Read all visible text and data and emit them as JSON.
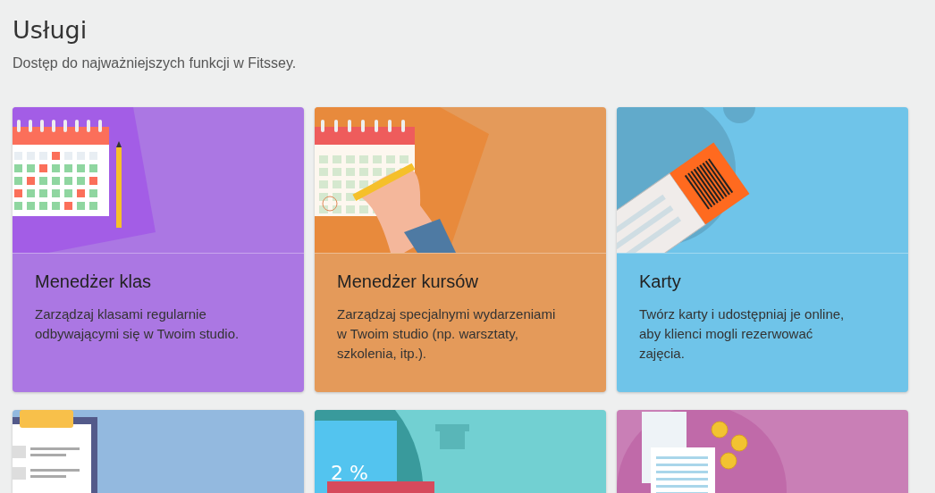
{
  "title": "Usługi",
  "subtitle": "Dostęp do najważniejszych funkcji w Fitssey.",
  "cards": [
    {
      "kind": "calendar",
      "color": "#ab77e3",
      "title": "Menedżer klas",
      "description": "Zarządzaj klasami regularnie odbywającymi się w Twoim studio."
    },
    {
      "kind": "hand",
      "color": "#e49a5a",
      "title": "Menedżer kursów",
      "description": "Zarządzaj specjalnymi wydarzeniami w Twoim studio (np. warsztaty, szkolenia, itp.)."
    },
    {
      "kind": "ticket",
      "color": "#6fc4e9",
      "title": "Karty",
      "description": "Twórz karty i udostępniaj je online, aby klienci mogli rezerwować zajęcia."
    },
    {
      "kind": "clipboard",
      "color": "#93b9df"
    },
    {
      "kind": "discount",
      "color": "#72d0d2",
      "badge": "2 %"
    },
    {
      "kind": "receipt",
      "color": "#c97fb6"
    }
  ]
}
